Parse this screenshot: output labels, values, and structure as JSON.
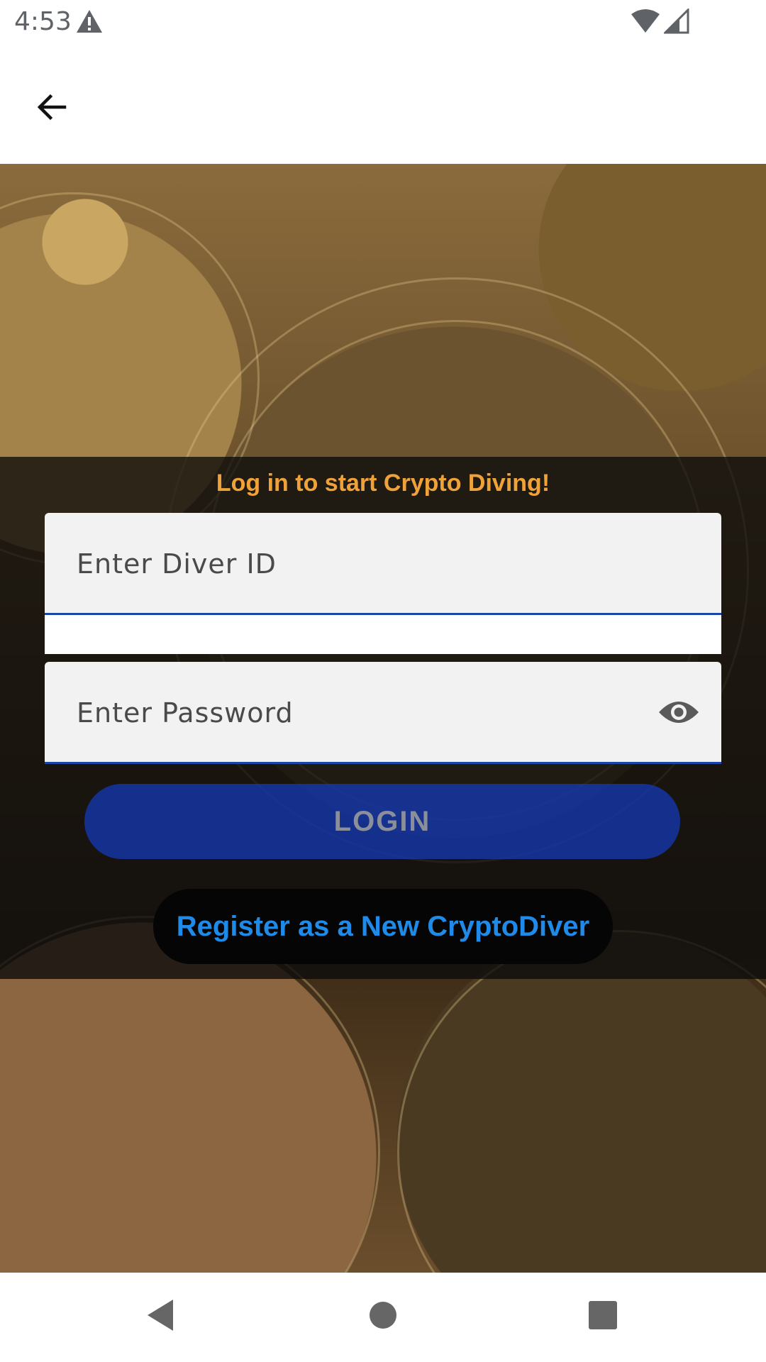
{
  "status_bar": {
    "time": "4:53",
    "icons": [
      "warning-icon",
      "wifi-icon",
      "cell-signal-icon"
    ]
  },
  "app_bar": {
    "back_icon": "arrow-left-icon"
  },
  "login": {
    "headline": "Log in to start Crypto Diving!",
    "diver_id_placeholder": "Enter Diver ID",
    "diver_id_value": "",
    "password_placeholder": "Enter Password",
    "password_value": "",
    "password_toggle_icon": "eye-icon",
    "login_label": "LOGIN",
    "register_label": "Register as a New CryptoDiver"
  },
  "nav_bar": {
    "icons": [
      "back-triangle-icon",
      "home-circle-icon",
      "recents-square-icon"
    ]
  },
  "colors": {
    "headline": "#f0a23a",
    "field_underline": "#1a47a8",
    "login_button": "#143cbe",
    "register_text": "#1f8ae8"
  }
}
